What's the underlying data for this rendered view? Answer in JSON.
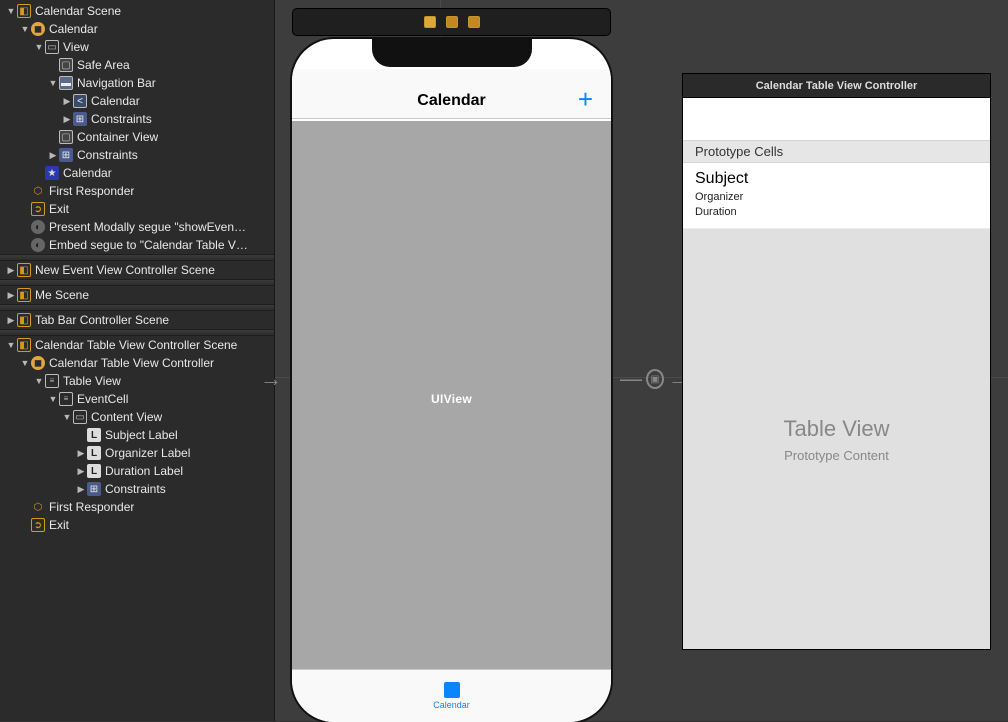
{
  "outline": {
    "scene1": {
      "title": "Calendar Scene",
      "calendar_vc": "Calendar",
      "view": "View",
      "safe_area": "Safe Area",
      "navigation_bar": "Navigation Bar",
      "nav_calendar": "Calendar",
      "nav_constraints": "Constraints",
      "container_view": "Container View",
      "constraints": "Constraints",
      "calendar_star": "Calendar",
      "first_responder": "First Responder",
      "exit": "Exit",
      "segue_modal": "Present Modally segue \"showEven…",
      "segue_embed": "Embed segue to \"Calendar Table V…"
    },
    "scene2": "New Event View Controller Scene",
    "scene3": "Me Scene",
    "scene4": "Tab Bar Controller Scene",
    "scene5": {
      "title": "Calendar Table View Controller Scene",
      "tvc": "Calendar Table View Controller",
      "table_view": "Table View",
      "event_cell": "EventCell",
      "content_view": "Content View",
      "subject_label": "Subject Label",
      "organizer_label": "Organizer Label",
      "duration_label": "Duration Label",
      "constraints": "Constraints",
      "first_responder": "First Responder",
      "exit": "Exit"
    }
  },
  "device": {
    "nav_title": "Calendar",
    "uiview_text": "UIView",
    "tab_label": "Calendar"
  },
  "tvc": {
    "title": "Calendar Table View Controller",
    "prototype_header": "Prototype Cells",
    "subject": "Subject",
    "organizer": "Organizer",
    "duration": "Duration",
    "big": "Table View",
    "sub": "Prototype Content"
  }
}
